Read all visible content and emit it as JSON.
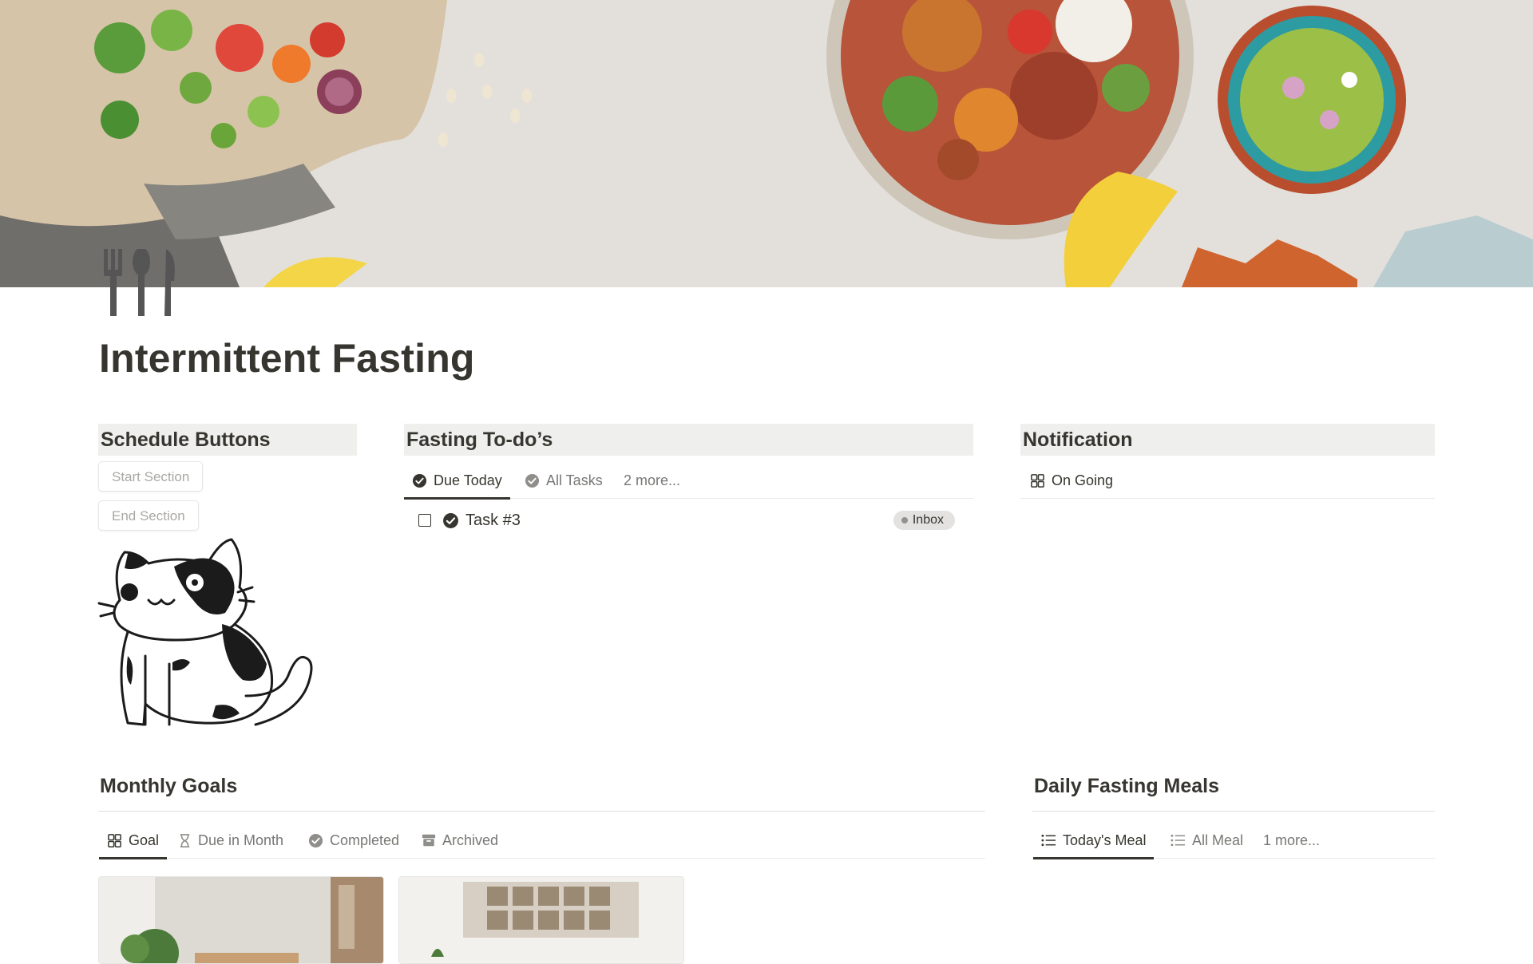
{
  "page": {
    "title": "Intermittent Fasting",
    "icon": "fork-knife-spoon-icon"
  },
  "schedule": {
    "header": "Schedule Buttons",
    "start_label": "Start Section",
    "end_label": "End Section",
    "illustration": "cat-illustration"
  },
  "todos": {
    "header": "Fasting To-do’s",
    "tabs": [
      {
        "label": "Due Today",
        "icon": "check-circle-icon",
        "active": true
      },
      {
        "label": "All Tasks",
        "icon": "check-circle-icon",
        "active": false
      },
      {
        "label": "2 more...",
        "icon": "",
        "active": false
      }
    ],
    "tasks": [
      {
        "name": "Task #3",
        "status": "Inbox",
        "checked": false
      }
    ]
  },
  "notification": {
    "header": "Notification",
    "tabs": [
      {
        "label": "On Going",
        "icon": "gallery-grid-icon",
        "active": true
      }
    ]
  },
  "goals": {
    "header": "Monthly Goals",
    "tabs": [
      {
        "label": "Goal",
        "icon": "gallery-grid-icon",
        "active": true
      },
      {
        "label": "Due in Month",
        "icon": "hourglass-icon",
        "active": false
      },
      {
        "label": "Completed",
        "icon": "check-circle-icon",
        "active": false
      },
      {
        "label": "Archived",
        "icon": "archive-box-icon",
        "active": false
      }
    ]
  },
  "meals": {
    "header": "Daily Fasting Meals",
    "tabs": [
      {
        "label": "Today's Meal",
        "icon": "list-icon",
        "active": true
      },
      {
        "label": "All Meal",
        "icon": "list-icon",
        "active": false
      },
      {
        "label": "1 more...",
        "icon": "",
        "active": false
      }
    ]
  },
  "colors": {
    "text": "#37352f",
    "muted": "#787774",
    "band": "#efefed",
    "pill": "#e3e2e0"
  }
}
